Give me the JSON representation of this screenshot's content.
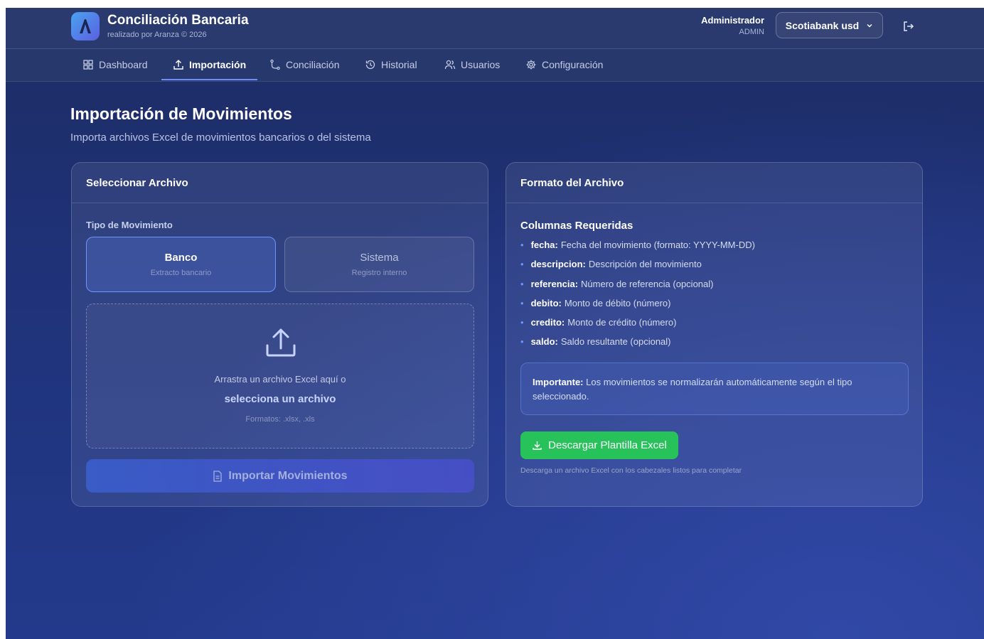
{
  "header": {
    "app_title": "Conciliación Bancaria",
    "app_subtitle": "realizado por Aranza © 2026",
    "user_name": "Administrador",
    "user_role": "ADMIN",
    "bank_selected": "Scotiabank usd"
  },
  "nav": {
    "tabs": [
      {
        "label": "Dashboard",
        "icon": "grid-icon"
      },
      {
        "label": "Importación",
        "icon": "upload-icon",
        "active": true
      },
      {
        "label": "Conciliación",
        "icon": "route-icon"
      },
      {
        "label": "Historial",
        "icon": "history-icon"
      },
      {
        "label": "Usuarios",
        "icon": "users-icon"
      },
      {
        "label": "Configuración",
        "icon": "gear-icon"
      }
    ]
  },
  "page": {
    "title": "Importación de Movimientos",
    "subtitle": "Importa archivos Excel de movimientos bancarios o del sistema"
  },
  "select_card": {
    "title": "Seleccionar Archivo",
    "type_label": "Tipo de Movimiento",
    "types": [
      {
        "title": "Banco",
        "subtitle": "Extracto bancario",
        "selected": true
      },
      {
        "title": "Sistema",
        "subtitle": "Registro interno",
        "selected": false
      }
    ],
    "drop_text": "Arrastra un archivo Excel aquí o",
    "drop_link": "selecciona un archivo",
    "drop_formats": "Formatos: .xlsx, .xls",
    "import_button": "Importar Movimientos"
  },
  "format_card": {
    "title": "Formato del Archivo",
    "required_title": "Columnas Requeridas",
    "columns": [
      {
        "name": "fecha:",
        "desc": "Fecha del movimiento (formato: YYYY-MM-DD)"
      },
      {
        "name": "descripcion:",
        "desc": "Descripción del movimiento"
      },
      {
        "name": "referencia:",
        "desc": "Número de referencia (opcional)"
      },
      {
        "name": "debito:",
        "desc": "Monto de débito (número)"
      },
      {
        "name": "credito:",
        "desc": "Monto de crédito (número)"
      },
      {
        "name": "saldo:",
        "desc": "Saldo resultante (opcional)"
      }
    ],
    "notice_bold": "Importante:",
    "notice_text": "Los movimientos se normalizarán automáticamente según el tipo seleccionado.",
    "download_button": "Descargar Plantilla Excel",
    "download_note": "Descarga un archivo Excel con los cabezales listos para completar"
  },
  "colors": {
    "accent": "#6f93ff",
    "success": "#27c25a",
    "background": "#1f3278"
  }
}
